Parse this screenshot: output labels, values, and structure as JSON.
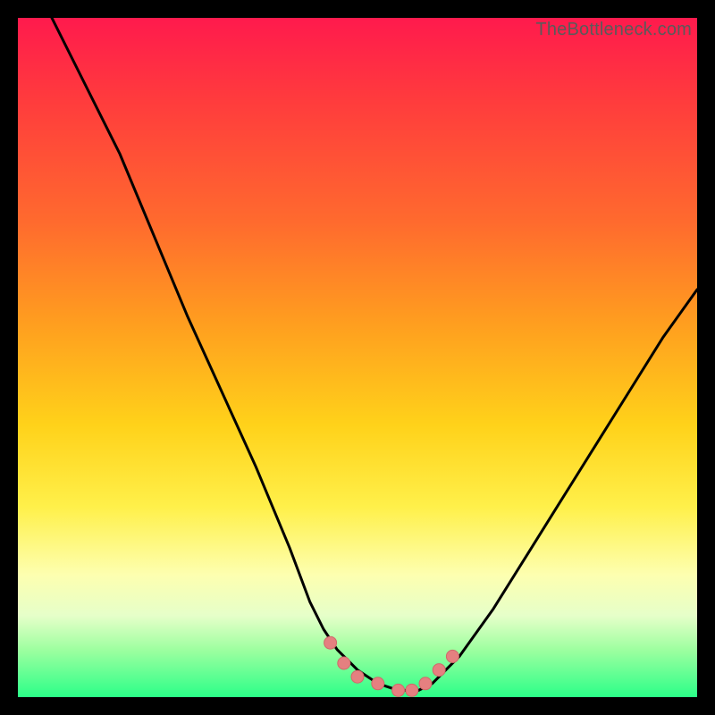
{
  "watermark": {
    "text": "TheBottleneck.com"
  },
  "colors": {
    "curve": "#000000",
    "marker_fill": "#e58080",
    "marker_stroke": "#cf6a6a",
    "background_stops": [
      "#ff1a4d",
      "#ff3b3d",
      "#ff6a2e",
      "#ff9e1f",
      "#ffd21a",
      "#fff04a",
      "#fdffb0",
      "#e6ffc9",
      "#9effa0",
      "#2bff88"
    ]
  },
  "chart_data": {
    "type": "line",
    "title": "",
    "xlabel": "",
    "ylabel": "",
    "xlim": [
      0,
      100
    ],
    "ylim": [
      0,
      100
    ],
    "grid": false,
    "legend": false,
    "series": [
      {
        "name": "bottleneck-curve",
        "x": [
          5,
          10,
          15,
          20,
          25,
          30,
          35,
          40,
          43,
          45,
          47,
          50,
          53,
          56,
          59,
          61,
          63,
          65,
          70,
          75,
          80,
          85,
          90,
          95,
          100
        ],
        "y": [
          100,
          90,
          80,
          68,
          56,
          45,
          34,
          22,
          14,
          10,
          7,
          4,
          2,
          1,
          1,
          2,
          4,
          6,
          13,
          21,
          29,
          37,
          45,
          53,
          60
        ]
      }
    ],
    "markers": {
      "name": "highlighted-points",
      "x": [
        46,
        48,
        50,
        53,
        56,
        58,
        60,
        62,
        64
      ],
      "y": [
        8,
        5,
        3,
        2,
        1,
        1,
        2,
        4,
        6
      ]
    }
  }
}
